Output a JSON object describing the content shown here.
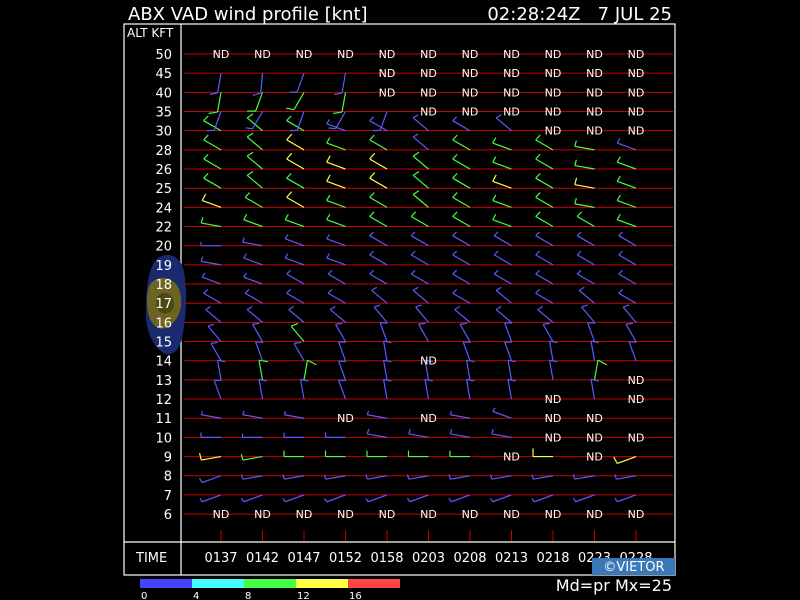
{
  "header": {
    "title": "ABX VAD wind profile [knt]",
    "timestamp": "02:28:24Z   7 JUL 25"
  },
  "axis": {
    "alt_label": "ALT KFT",
    "time_label": "TIME"
  },
  "footer": {
    "credit": "©VIETOR",
    "mode": "Md=pr Mx=25"
  },
  "colors": {
    "background": "#000000",
    "frame": "#ffffff",
    "gridline": "#cc0000",
    "tick": "#cc0000"
  },
  "legend": {
    "ticks": [
      "0",
      "4",
      "8",
      "12",
      "16"
    ],
    "colors": [
      "#4444ff",
      "#44ffff",
      "#44ff44",
      "#ffff44",
      "#ff4444"
    ]
  },
  "chart_data": {
    "type": "wind_profile",
    "title": "ABX VAD wind profile [knt]",
    "units": "knt",
    "altitudes_kft": [
      50,
      45,
      40,
      35,
      30,
      28,
      26,
      25,
      24,
      22,
      20,
      19,
      18,
      17,
      16,
      15,
      14,
      13,
      12,
      11,
      10,
      9,
      8,
      7,
      6
    ],
    "times": [
      "0137",
      "0142",
      "0147",
      "0152",
      "0158",
      "0203",
      "0208",
      "0213",
      "0218",
      "0223",
      "0228"
    ],
    "no_data_marker": "ND",
    "no_data": [
      [
        "50",
        "0137"
      ],
      [
        "50",
        "0142"
      ],
      [
        "50",
        "0147"
      ],
      [
        "50",
        "0152"
      ],
      [
        "50",
        "0158"
      ],
      [
        "50",
        "0203"
      ],
      [
        "50",
        "0208"
      ],
      [
        "50",
        "0213"
      ],
      [
        "50",
        "0218"
      ],
      [
        "50",
        "0223"
      ],
      [
        "50",
        "0228"
      ],
      [
        "45",
        "0158"
      ],
      [
        "45",
        "0203"
      ],
      [
        "45",
        "0208"
      ],
      [
        "45",
        "0213"
      ],
      [
        "45",
        "0218"
      ],
      [
        "45",
        "0223"
      ],
      [
        "45",
        "0228"
      ],
      [
        "40",
        "0158"
      ],
      [
        "40",
        "0203"
      ],
      [
        "40",
        "0208"
      ],
      [
        "40",
        "0213"
      ],
      [
        "40",
        "0218"
      ],
      [
        "40",
        "0223"
      ],
      [
        "40",
        "0228"
      ],
      [
        "35",
        "0203"
      ],
      [
        "35",
        "0208"
      ],
      [
        "35",
        "0213"
      ],
      [
        "35",
        "0218"
      ],
      [
        "35",
        "0223"
      ],
      [
        "35",
        "0228"
      ],
      [
        "30",
        "0218"
      ],
      [
        "30",
        "0223"
      ],
      [
        "30",
        "0228"
      ],
      [
        "14",
        "0203"
      ],
      [
        "13",
        "0228"
      ],
      [
        "12",
        "0218"
      ],
      [
        "12",
        "0228"
      ],
      [
        "11",
        "0152"
      ],
      [
        "11",
        "0203"
      ],
      [
        "11",
        "0218"
      ],
      [
        "11",
        "0223"
      ],
      [
        "10",
        "0218"
      ],
      [
        "10",
        "0223"
      ],
      [
        "10",
        "0228"
      ],
      [
        "9",
        "0213"
      ],
      [
        "9",
        "0223"
      ],
      [
        "6",
        "0137"
      ],
      [
        "6",
        "0142"
      ],
      [
        "6",
        "0147"
      ],
      [
        "6",
        "0152"
      ],
      [
        "6",
        "0158"
      ],
      [
        "6",
        "0203"
      ],
      [
        "6",
        "0208"
      ],
      [
        "6",
        "0213"
      ],
      [
        "6",
        "0218"
      ],
      [
        "6",
        "0223"
      ],
      [
        "6",
        "0228"
      ]
    ],
    "winds": {
      "45": {
        "0137": [
          190,
          8
        ],
        "0142": [
          185,
          8
        ],
        "0147": [
          200,
          8
        ],
        "0152": [
          190,
          8
        ]
      },
      "40": {
        "0137": [
          190,
          10
        ],
        "0142": [
          200,
          10
        ],
        "0147": [
          210,
          10
        ],
        "0152": [
          190,
          10
        ]
      },
      "35": {
        "0137": [
          200,
          8
        ],
        "0142": [
          210,
          8
        ],
        "0147": [
          200,
          8
        ],
        "0152": [
          210,
          8
        ],
        "0158": [
          200,
          8
        ]
      },
      "30": {
        "0137": [
          300,
          10
        ],
        "0142": [
          310,
          10
        ],
        "0147": [
          300,
          10
        ],
        "0152": [
          290,
          8
        ],
        "0158": [
          300,
          8
        ],
        "0203": [
          310,
          8
        ],
        "0208": [
          300,
          8
        ],
        "0213": [
          310,
          8
        ]
      },
      "28": {
        "0137": [
          300,
          10
        ],
        "0142": [
          310,
          10
        ],
        "0147": [
          300,
          12
        ],
        "0152": [
          290,
          10
        ],
        "0158": [
          300,
          10
        ],
        "0203": [
          310,
          8
        ],
        "0208": [
          300,
          10
        ],
        "0213": [
          290,
          10
        ],
        "0218": [
          300,
          10
        ],
        "0223": [
          280,
          10
        ],
        "0228": [
          290,
          8
        ]
      },
      "26": {
        "0137": [
          300,
          10
        ],
        "0142": [
          310,
          10
        ],
        "0147": [
          300,
          12
        ],
        "0152": [
          290,
          12
        ],
        "0158": [
          300,
          12
        ],
        "0203": [
          310,
          10
        ],
        "0208": [
          300,
          10
        ],
        "0213": [
          290,
          10
        ],
        "0218": [
          300,
          10
        ],
        "0223": [
          280,
          10
        ],
        "0228": [
          290,
          10
        ]
      },
      "25": {
        "0137": [
          300,
          10
        ],
        "0142": [
          310,
          10
        ],
        "0147": [
          300,
          10
        ],
        "0152": [
          290,
          12
        ],
        "0158": [
          300,
          12
        ],
        "0203": [
          310,
          10
        ],
        "0208": [
          300,
          10
        ],
        "0213": [
          290,
          12
        ],
        "0218": [
          300,
          10
        ],
        "0223": [
          280,
          12
        ],
        "0228": [
          290,
          10
        ]
      },
      "24": {
        "0137": [
          290,
          12
        ],
        "0142": [
          300,
          10
        ],
        "0147": [
          300,
          12
        ],
        "0152": [
          290,
          10
        ],
        "0158": [
          300,
          10
        ],
        "0203": [
          310,
          10
        ],
        "0208": [
          300,
          10
        ],
        "0213": [
          290,
          10
        ],
        "0218": [
          300,
          10
        ],
        "0223": [
          280,
          10
        ],
        "0228": [
          290,
          10
        ]
      },
      "22": {
        "0137": [
          280,
          10
        ],
        "0142": [
          290,
          10
        ],
        "0147": [
          290,
          10
        ],
        "0152": [
          290,
          10
        ],
        "0158": [
          300,
          10
        ],
        "0203": [
          300,
          10
        ],
        "0208": [
          300,
          10
        ],
        "0213": [
          290,
          10
        ],
        "0218": [
          300,
          10
        ],
        "0223": [
          300,
          10
        ],
        "0228": [
          290,
          10
        ]
      },
      "20": {
        "0137": [
          270,
          6
        ],
        "0142": [
          280,
          8
        ],
        "0147": [
          290,
          8
        ],
        "0152": [
          290,
          8
        ],
        "0158": [
          300,
          8
        ],
        "0203": [
          300,
          8
        ],
        "0208": [
          300,
          8
        ],
        "0213": [
          300,
          8
        ],
        "0218": [
          300,
          8
        ],
        "0223": [
          300,
          8
        ],
        "0228": [
          300,
          8
        ]
      },
      "19": {
        "0137": [
          280,
          8
        ],
        "0142": [
          290,
          8
        ],
        "0147": [
          290,
          8
        ],
        "0152": [
          290,
          8
        ],
        "0158": [
          300,
          8
        ],
        "0203": [
          300,
          8
        ],
        "0208": [
          300,
          8
        ],
        "0213": [
          300,
          8
        ],
        "0218": [
          300,
          8
        ],
        "0223": [
          300,
          8
        ],
        "0228": [
          300,
          8
        ]
      },
      "18": {
        "0137": [
          290,
          8
        ],
        "0142": [
          290,
          8
        ],
        "0147": [
          300,
          8
        ],
        "0152": [
          300,
          8
        ],
        "0158": [
          300,
          8
        ],
        "0203": [
          300,
          8
        ],
        "0208": [
          300,
          8
        ],
        "0213": [
          300,
          8
        ],
        "0218": [
          300,
          8
        ],
        "0223": [
          300,
          8
        ],
        "0228": [
          300,
          8
        ]
      },
      "17": {
        "0137": [
          300,
          8
        ],
        "0142": [
          300,
          8
        ],
        "0147": [
          300,
          8
        ],
        "0152": [
          300,
          8
        ],
        "0158": [
          310,
          8
        ],
        "0203": [
          310,
          8
        ],
        "0208": [
          300,
          8
        ],
        "0213": [
          310,
          8
        ],
        "0218": [
          300,
          8
        ],
        "0223": [
          310,
          8
        ],
        "0228": [
          300,
          8
        ]
      },
      "16": {
        "0137": [
          310,
          8
        ],
        "0142": [
          310,
          8
        ],
        "0147": [
          310,
          8
        ],
        "0152": [
          310,
          8
        ],
        "0158": [
          320,
          8
        ],
        "0203": [
          320,
          8
        ],
        "0208": [
          310,
          8
        ],
        "0213": [
          310,
          8
        ],
        "0218": [
          310,
          8
        ],
        "0223": [
          320,
          8
        ],
        "0228": [
          320,
          8
        ]
      },
      "15": {
        "0137": [
          320,
          8
        ],
        "0142": [
          330,
          8
        ],
        "0147": [
          320,
          10
        ],
        "0152": [
          330,
          8
        ],
        "0158": [
          340,
          8
        ],
        "0203": [
          330,
          8
        ],
        "0208": [
          330,
          8
        ],
        "0213": [
          340,
          8
        ],
        "0218": [
          330,
          8
        ],
        "0223": [
          340,
          8
        ],
        "0228": [
          330,
          8
        ]
      },
      "14": {
        "0137": [
          330,
          8
        ],
        "0142": [
          340,
          8
        ],
        "0147": [
          330,
          8
        ],
        "0152": [
          340,
          8
        ],
        "0158": [
          350,
          8
        ],
        "0208": [
          340,
          8
        ],
        "0213": [
          340,
          8
        ],
        "0218": [
          350,
          8
        ],
        "0223": [
          350,
          8
        ],
        "0228": [
          340,
          8
        ]
      },
      "13": {
        "0137": [
          350,
          8
        ],
        "0142": [
          350,
          10
        ],
        "0147": [
          10,
          10
        ],
        "0152": [
          340,
          8
        ],
        "0158": [
          350,
          8
        ],
        "0203": [
          350,
          8
        ],
        "0208": [
          350,
          8
        ],
        "0213": [
          350,
          8
        ],
        "0218": [
          350,
          8
        ],
        "0223": [
          10,
          10
        ]
      },
      "12": {
        "0137": [
          340,
          8
        ],
        "0142": [
          350,
          8
        ],
        "0147": [
          350,
          8
        ],
        "0152": [
          340,
          8
        ],
        "0158": [
          350,
          8
        ],
        "0203": [
          350,
          8
        ],
        "0208": [
          350,
          8
        ],
        "0213": [
          350,
          8
        ],
        "0223": [
          350,
          8
        ]
      },
      "11": {
        "0137": [
          280,
          6
        ],
        "0142": [
          280,
          6
        ],
        "0147": [
          280,
          6
        ],
        "0158": [
          280,
          6
        ],
        "0208": [
          280,
          6
        ],
        "0213": [
          290,
          6
        ]
      },
      "10": {
        "0137": [
          270,
          8
        ],
        "0142": [
          270,
          6
        ],
        "0147": [
          270,
          8
        ],
        "0152": [
          270,
          8
        ],
        "0158": [
          280,
          8
        ],
        "0203": [
          280,
          8
        ],
        "0208": [
          280,
          8
        ],
        "0213": [
          280,
          8
        ]
      },
      "9": {
        "0137": [
          260,
          12
        ],
        "0142": [
          260,
          10
        ],
        "0147": [
          270,
          10
        ],
        "0152": [
          270,
          10
        ],
        "0158": [
          270,
          10
        ],
        "0203": [
          270,
          10
        ],
        "0208": [
          270,
          10
        ],
        "0218": [
          270,
          14
        ],
        "0228": [
          250,
          12
        ]
      },
      "8": {
        "0137": [
          250,
          8
        ],
        "0142": [
          260,
          8
        ],
        "0147": [
          260,
          8
        ],
        "0152": [
          260,
          8
        ],
        "0158": [
          260,
          8
        ],
        "0203": [
          260,
          8
        ],
        "0208": [
          260,
          8
        ],
        "0213": [
          260,
          8
        ],
        "0218": [
          260,
          8
        ],
        "0223": [
          260,
          8
        ],
        "0228": [
          260,
          8
        ]
      },
      "7": {
        "0137": [
          250,
          6
        ],
        "0142": [
          250,
          6
        ],
        "0147": [
          250,
          6
        ],
        "0152": [
          250,
          6
        ],
        "0158": [
          250,
          6
        ],
        "0203": [
          250,
          6
        ],
        "0208": [
          250,
          6
        ],
        "0213": [
          250,
          6
        ],
        "0218": [
          250,
          6
        ],
        "0223": [
          250,
          6
        ],
        "0228": [
          250,
          6
        ]
      }
    }
  }
}
